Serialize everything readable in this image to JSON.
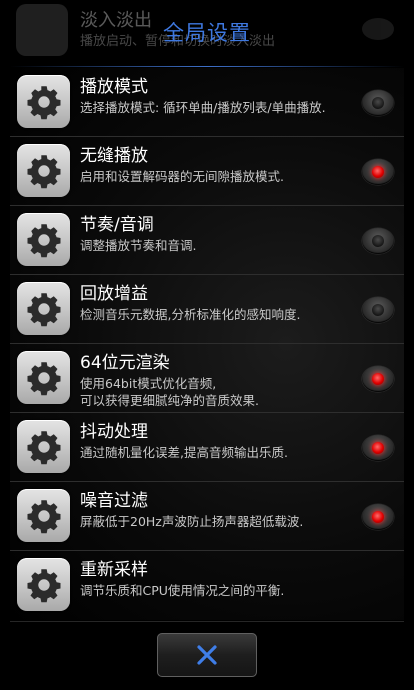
{
  "background_item": {
    "title": "淡入淡出",
    "description": "播放启动、暂停和切换时淡入淡出"
  },
  "dialog": {
    "title": "全局设置"
  },
  "settings": [
    {
      "title": "播放模式",
      "description": "选择播放模式: 循环单曲/播放列表/单曲播放.",
      "toggle": "off"
    },
    {
      "title": "无缝播放",
      "description": "启用和设置解码器的无间隙播放模式.",
      "toggle": "on"
    },
    {
      "title": "节奏/音调",
      "description": "调整播放节奏和音调.",
      "toggle": "off"
    },
    {
      "title": "回放增益",
      "description": "检测音乐元数据,分析标准化的感知响度.",
      "toggle": "off"
    },
    {
      "title": "64位元渲染",
      "description": "使用64bit模式优化音频,\n可以获得更细腻纯净的音质效果.",
      "toggle": "on"
    },
    {
      "title": "抖动处理",
      "description": "通过随机量化误差,提高音频输出乐质.",
      "toggle": "on"
    },
    {
      "title": "噪音过滤",
      "description": "屏蔽低于20Hz声波防止扬声器超低载波.",
      "toggle": "on"
    },
    {
      "title": "重新采样",
      "description": "调节乐质和CPU使用情况之间的平衡.",
      "toggle": null
    }
  ],
  "icons": {
    "row_icon": "gear-icon",
    "close_icon": "close-x-icon"
  },
  "colors": {
    "title": "#3e78e0",
    "toggle_on": "#e00000",
    "close_x": "#3f7ee8"
  }
}
